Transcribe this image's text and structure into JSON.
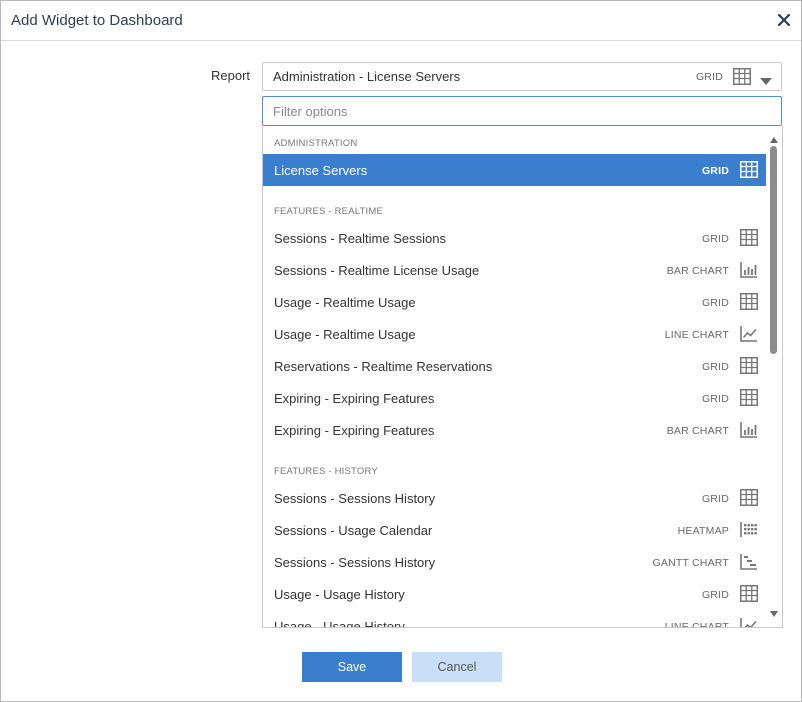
{
  "dialog": {
    "title": "Add Widget to Dashboard"
  },
  "form": {
    "report_label": "Report",
    "selected_report": "Administration - License Servers",
    "selected_type": "GRID",
    "filter_placeholder": "Filter options"
  },
  "groups": [
    {
      "label": "ADMINISTRATION",
      "options": [
        {
          "label": "License Servers",
          "type": "GRID",
          "icon": "grid-icon",
          "selected": true
        }
      ]
    },
    {
      "label": "FEATURES - REALTIME",
      "options": [
        {
          "label": "Sessions - Realtime Sessions",
          "type": "GRID",
          "icon": "grid-icon"
        },
        {
          "label": "Sessions - Realtime License Usage",
          "type": "BAR CHART",
          "icon": "bar-chart-icon"
        },
        {
          "label": "Usage - Realtime Usage",
          "type": "GRID",
          "icon": "grid-icon"
        },
        {
          "label": "Usage - Realtime Usage",
          "type": "LINE CHART",
          "icon": "line-chart-icon"
        },
        {
          "label": "Reservations - Realtime Reservations",
          "type": "GRID",
          "icon": "grid-icon"
        },
        {
          "label": "Expiring - Expiring Features",
          "type": "GRID",
          "icon": "grid-icon"
        },
        {
          "label": "Expiring - Expiring Features",
          "type": "BAR CHART",
          "icon": "bar-chart-icon"
        }
      ]
    },
    {
      "label": "FEATURES - HISTORY",
      "options": [
        {
          "label": "Sessions - Sessions History",
          "type": "GRID",
          "icon": "grid-icon"
        },
        {
          "label": "Sessions - Usage Calendar",
          "type": "HEATMAP",
          "icon": "heatmap-icon"
        },
        {
          "label": "Sessions - Sessions History",
          "type": "GANTT CHART",
          "icon": "gantt-chart-icon"
        },
        {
          "label": "Usage - Usage History",
          "type": "GRID",
          "icon": "grid-icon"
        },
        {
          "label": "Usage - Usage History",
          "type": "LINE CHART",
          "icon": "line-chart-icon"
        }
      ]
    }
  ],
  "buttons": {
    "save": "Save",
    "cancel": "Cancel"
  },
  "colors": {
    "accent": "#3a7fcd",
    "cancel_bg": "#c9dff6",
    "icon": "#777777"
  }
}
